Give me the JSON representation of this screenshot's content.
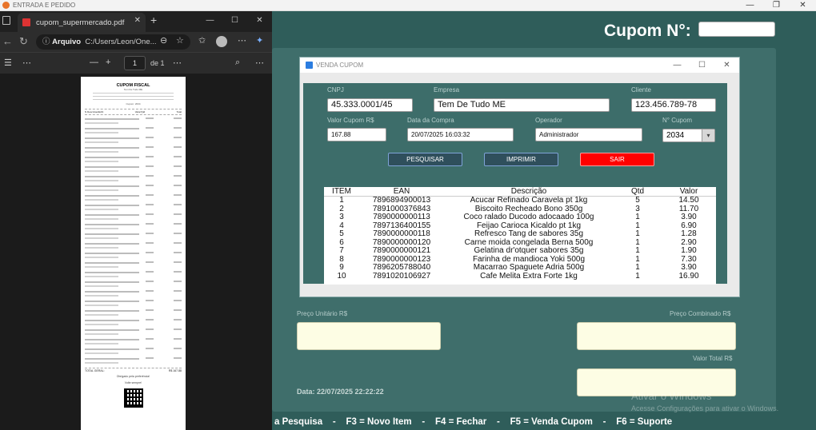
{
  "app": {
    "title": "ENTRADA E PEDIDO",
    "cupom_label": "Cupom N°:",
    "cupom_value": "",
    "labels": {
      "preco_unitario": "Preço Unitário R$",
      "preco_combinado": "Preço Combinado R$",
      "valor_total": "Valor Total R$"
    },
    "data_text": "Data: 22/07/2025 22:22:22",
    "watermark_title": "Ativar o Windows",
    "watermark_sub": "Acesse Configurações para ativar o Windows.",
    "shortcuts": "a Pesquisa    -    F3 = Novo Item    -    F4 = Fechar    -    F5 = Venda Cupom    -    F6 = Suporte"
  },
  "modal": {
    "title": "VENDA CUPOM",
    "fields": {
      "cnpj": {
        "label": "CNPJ",
        "value": "45.333.0001/45"
      },
      "empresa": {
        "label": "Empresa",
        "value": "Tem De Tudo ME"
      },
      "cliente": {
        "label": "Cliente",
        "value": "123.456.789-78"
      },
      "valor_cupom": {
        "label": "Valor Cupom R$",
        "value": "167.88"
      },
      "data_compra": {
        "label": "Data da Compra",
        "value": "20/07/2025 16:03:32"
      },
      "operador": {
        "label": "Operador",
        "value": "Administrador"
      },
      "n_cupom": {
        "label": "N° Cupom",
        "value": "2034"
      }
    },
    "buttons": {
      "pesquisar": "PESQUISAR",
      "imprimir": "IMPRIMIR",
      "sair": "SAIR"
    },
    "colors": {
      "sair": "#ff0000",
      "btn_dark": "#2f4f5c",
      "btn_border": "#7fa3d8"
    },
    "table": {
      "headers": [
        "ITEM",
        "EAN",
        "Descrição",
        "Qtd",
        "Valor"
      ],
      "rows": [
        [
          "1",
          "7896894900013",
          "Acucar Refinado Caravela pt 1kg",
          "5",
          "14.50"
        ],
        [
          "2",
          "7891000376843",
          "Biscoito Recheado Bono 350g",
          "3",
          "11.70"
        ],
        [
          "3",
          "7890000000113",
          "Coco ralado Ducodo adocaado 100g",
          "1",
          "3.90"
        ],
        [
          "4",
          "7897136400155",
          "Feijao Carioca Kicaldo pt 1kg",
          "1",
          "6.90"
        ],
        [
          "5",
          "7890000000118",
          "Refresco Tang de sabores 35g",
          "1",
          "1.28"
        ],
        [
          "6",
          "7890000000120",
          "Carne moida congelada Berna 500g",
          "1",
          "2.90"
        ],
        [
          "7",
          "7890000000121",
          "Gelatina dr'otquer sabores 35g",
          "1",
          "1.90"
        ],
        [
          "8",
          "7890000000123",
          "Farinha de mandioca Yoki 500g",
          "1",
          "7.30"
        ],
        [
          "9",
          "7896205788040",
          "Macarrao Spaguete Adria 500g",
          "1",
          "3.90"
        ],
        [
          "10",
          "7891020106927",
          "Cafe Melita Extra Forte 1kg",
          "1",
          "16.90"
        ]
      ]
    }
  },
  "pdf": {
    "tab_title": "cupom_supermercado.pdf",
    "address_prefix": "Arquivo",
    "address": "C:/Users/Leon/One...",
    "page_current": "1",
    "page_total": "de 1",
    "receipt": {
      "title": "CUPOM FISCAL",
      "sub1": "Tem De Tudo ME",
      "sub2": "Cupom: 2034",
      "hdr_left": "N Descricao/EAN",
      "hdr_mid": "Valor/Qtd",
      "hdr_right": "Total",
      "total_left": "TOTAL GERAL:",
      "total_right": "R$ 167.88",
      "thanks1": "Obrigado pela preferência!",
      "thanks2": "Volte sempre!"
    }
  }
}
